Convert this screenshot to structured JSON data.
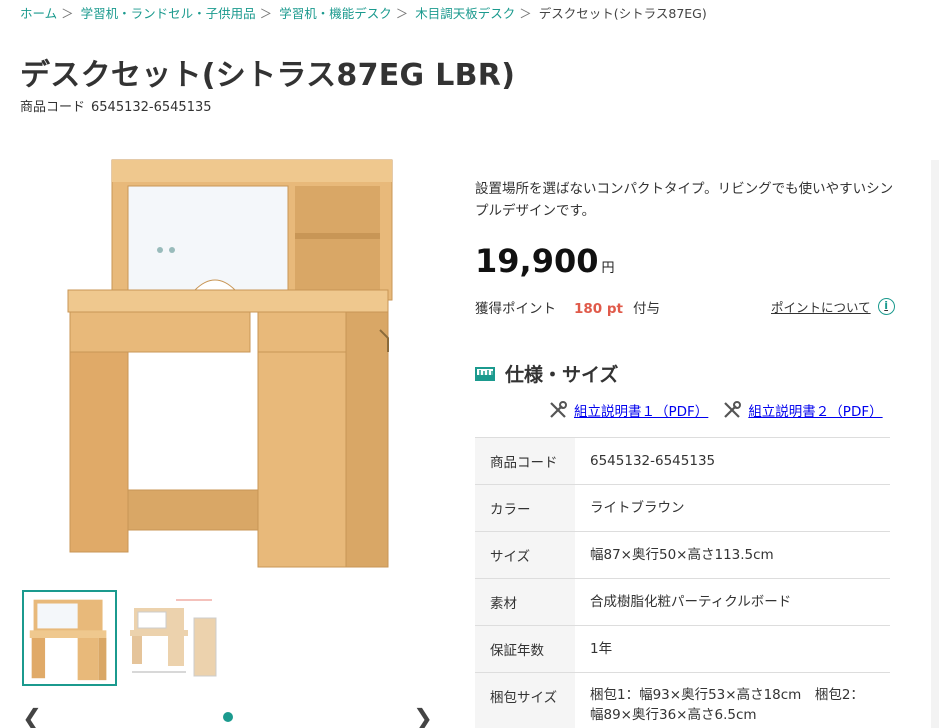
{
  "breadcrumb": {
    "items": [
      "ホーム",
      "学習机・ランドセル・子供用品",
      "学習机・機能デスク",
      "木目調天板デスク"
    ],
    "separator": "＞",
    "current": "デスクセット(シトラス87EG)"
  },
  "product": {
    "title": "デスクセット(シトラス87EG LBR)",
    "code_label": "商品コード",
    "code": "6545132-6545135",
    "description": "設置場所を選ばないコンパクトタイプ。リビングでも使いやすいシンプルデザインです。",
    "price": "19,900",
    "currency": "円",
    "points_label": "獲得ポイント",
    "points_value": "180 pt",
    "points_suffix": "付与",
    "points_about": "ポイントについて",
    "points_about_icon": "info-icon"
  },
  "spec": {
    "heading": "仕様・サイズ",
    "heading_icon": "ruler-icon",
    "manuals": [
      {
        "label": "組立説明書１（PDF）",
        "icon": "tools-icon"
      },
      {
        "label": "組立説明書２（PDF）",
        "icon": "tools-icon"
      }
    ],
    "rows": [
      {
        "key": "商品コード",
        "value": "6545132-6545135"
      },
      {
        "key": "カラー",
        "value": "ライトブラウン"
      },
      {
        "key": "サイズ",
        "value": "幅87×奥行50×高さ113.5cm"
      },
      {
        "key": "素材",
        "value": "合成樹脂化粧パーティクルボード"
      },
      {
        "key": "保証年数",
        "value": "1年"
      },
      {
        "key": "梱包サイズ",
        "value": "梱包1：幅93×奥行53×高さ18cm　梱包2：幅89×奥行36×高さ6.5cm"
      }
    ]
  },
  "gallery": {
    "thumbnail_count": 2,
    "active_index": 0,
    "prev_icon": "chevron-left-icon",
    "next_icon": "chevron-right-icon"
  },
  "colors": {
    "accent": "#1b9a8e",
    "points": "#e05a4a",
    "wood": "#e8b97a"
  }
}
